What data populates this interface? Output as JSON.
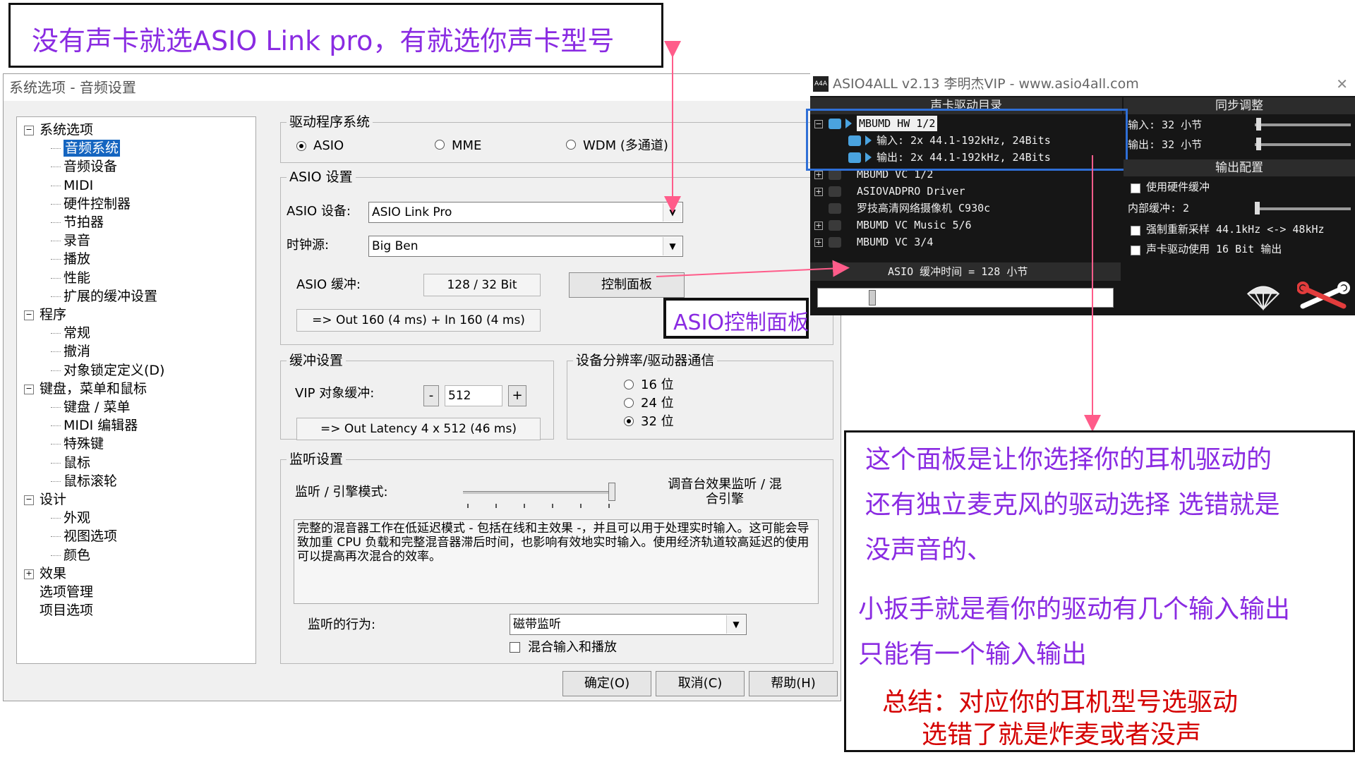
{
  "top_note": "没有声卡就选ASIO Link pro，有就选你声卡型号",
  "dialog": {
    "title": "系统选项 - 音频设置",
    "tree": [
      {
        "label": "系统选项",
        "level": 0,
        "expander": "−"
      },
      {
        "label": "音频系统",
        "level": 1,
        "selected": true
      },
      {
        "label": "音频设备",
        "level": 1
      },
      {
        "label": "MIDI",
        "level": 1
      },
      {
        "label": "硬件控制器",
        "level": 1
      },
      {
        "label": "节拍器",
        "level": 1
      },
      {
        "label": "录音",
        "level": 1
      },
      {
        "label": "播放",
        "level": 1
      },
      {
        "label": "性能",
        "level": 1
      },
      {
        "label": "扩展的缓冲设置",
        "level": 1
      },
      {
        "label": "程序",
        "level": 0,
        "expander": "−"
      },
      {
        "label": "常规",
        "level": 1
      },
      {
        "label": "撤消",
        "level": 1
      },
      {
        "label": "对象锁定定义(D)",
        "level": 1
      },
      {
        "label": "键盘，菜单和鼠标",
        "level": 0,
        "expander": "−"
      },
      {
        "label": "键盘 / 菜单",
        "level": 1
      },
      {
        "label": "MIDI 编辑器",
        "level": 1
      },
      {
        "label": "特殊键",
        "level": 1
      },
      {
        "label": "鼠标",
        "level": 1
      },
      {
        "label": "鼠标滚轮",
        "level": 1
      },
      {
        "label": "设计",
        "level": 0,
        "expander": "−"
      },
      {
        "label": "外观",
        "level": 1
      },
      {
        "label": "视图选项",
        "level": 1
      },
      {
        "label": "颜色",
        "level": 1
      },
      {
        "label": "效果",
        "level": 0,
        "expander": "+"
      },
      {
        "label": "选项管理",
        "level": 0
      },
      {
        "label": "项目选项",
        "level": 0
      }
    ],
    "driver_group": {
      "title": "驱动程序系统",
      "options": [
        {
          "label": "ASIO",
          "checked": true
        },
        {
          "label": "MME",
          "checked": false
        },
        {
          "label": "WDM (多通道)",
          "checked": false
        }
      ]
    },
    "asio_group": {
      "title": "ASIO 设置",
      "device_label": "ASIO 设备:",
      "device_value": "ASIO Link Pro",
      "clock_label": "时钟源:",
      "clock_value": "Big Ben",
      "buffer_label": "ASIO 缓冲:",
      "buffer_value": "128 / 32 Bit",
      "control_panel_button": "控制面板",
      "latency_text": "=> Out 160 (4 ms) + In 160 (4 ms)"
    },
    "buffer_group": {
      "title": "缓冲设置",
      "vip_label": "VIP 对象缓冲:",
      "minus": "-",
      "vip_value": "512",
      "plus": "+",
      "latency_text": "=> Out Latency 4 x 512 (46 ms)"
    },
    "resolution_group": {
      "title": "设备分辨率/驱动器通信",
      "options": [
        {
          "label": "16 位",
          "checked": false
        },
        {
          "label": "24 位",
          "checked": false
        },
        {
          "label": "32 位",
          "checked": true
        }
      ]
    },
    "monitor_group": {
      "title": "监听设置",
      "mode_label": "监听 / 引擎模式:",
      "slider_right_label": "调音台效果监听 / 混合引擎",
      "slider_level": 1.0,
      "description": "完整的混音器工作在低延迟模式 - 包括在线和主效果 -，并且可以用于处理实时输入。这可能会导致加重 CPU 负载和完整混音器滞后时间，也影响有效地实时输入。使用经济轨道较高延迟的使用可以提高再次混合的效率。",
      "behavior_label": "监听的行为:",
      "behavior_value": "磁带监听",
      "mix_checkbox_label": "混合输入和播放",
      "mix_checked": false
    },
    "buttons": {
      "ok": "确定(O)",
      "cancel": "取消(C)",
      "help": "帮助(H)"
    }
  },
  "asio_panel_note": "ASIO控制面板",
  "asio4all": {
    "title": "ASIO4ALL v2.13 李明杰VIP - www.asio4all.com",
    "close": "✕",
    "device_header": "声卡驱动目录",
    "sync_header": "同步调整",
    "output_header": "输出配置",
    "devices": [
      {
        "name": "MBUMD HW 1/2",
        "expander": "−",
        "active": true
      },
      {
        "name": "输入: 2x 44.1-192kHz, 24Bits",
        "sub": true,
        "active": true
      },
      {
        "name": "输出: 2x 44.1-192kHz, 24Bits",
        "sub": true,
        "active": true
      },
      {
        "name": "MBUMD VC 1/2",
        "expander": "+"
      },
      {
        "name": "ASIOVADPRO Driver",
        "expander": "+"
      },
      {
        "name": "罗技高清网络摄像机 C930c",
        "expander": ""
      },
      {
        "name": "MBUMD VC Music 5/6",
        "expander": "+"
      },
      {
        "name": "MBUMD VC 3/4",
        "expander": "+"
      }
    ],
    "sync_input": "输入: 32 小节",
    "sync_output": "输出: 32 小节",
    "hw_buffer": "使用硬件缓冲",
    "internal_buffer": "内部缓冲: 2",
    "resample": "强制重新采样 44.1kHz <-> 48kHz",
    "force16": "声卡驱动使用 16 Bit 输出",
    "buffer_time": "ASIO 缓冲时间 = 128 小节",
    "buffer_slider_level": 0.18
  },
  "notes": {
    "panel_desc": [
      "这个面板是让你选择你的耳机驱动的",
      "还有独立麦克风的驱动选择 选错就是",
      "没声音的、"
    ],
    "wrench_desc": [
      "小扳手就是看你的驱动有几个输入输出",
      "只能有一个输入输出"
    ],
    "summary": [
      "总结：对应你的耳机型号选驱动",
      "选错了就是炸麦或者没声"
    ]
  },
  "colors": {
    "annotation": "#8a2be2",
    "summary": "#d40000",
    "arrow": "#ff5c8a",
    "highlight": "#1565c0"
  }
}
